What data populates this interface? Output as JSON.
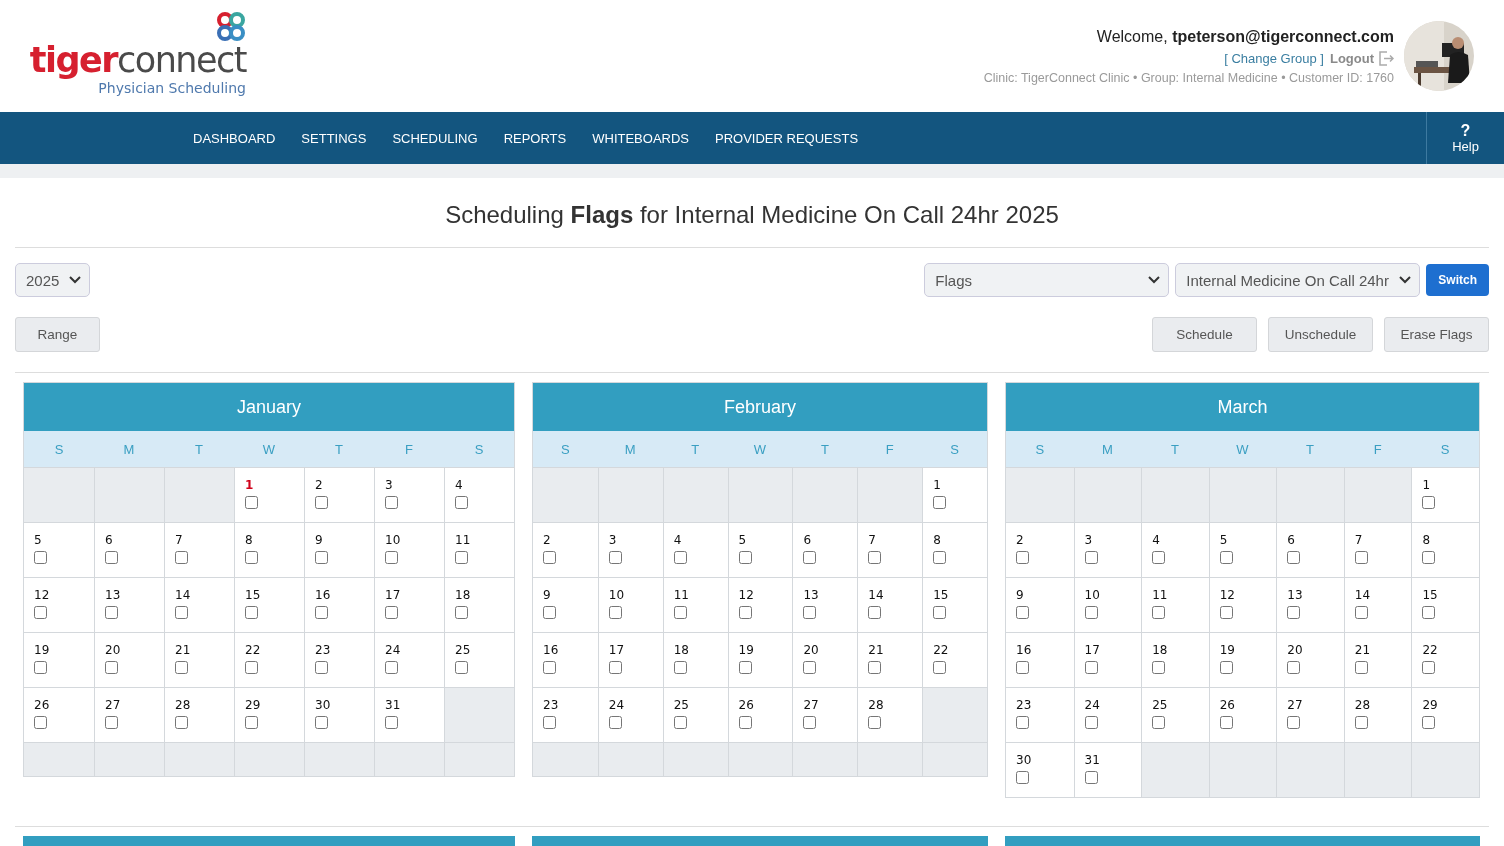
{
  "logo": {
    "brand_first": "tiger",
    "brand_second": "connect",
    "subtitle": "Physician Scheduling"
  },
  "user": {
    "welcome": "Welcome,",
    "email": "tpeterson@tigerconnect.com",
    "change_group": "[ Change Group ]",
    "logout": "Logout",
    "info": "Clinic: TigerConnect Clinic • Group: Internal Medicine • Customer ID: 1760"
  },
  "nav": {
    "items": [
      "DASHBOARD",
      "SETTINGS",
      "SCHEDULING",
      "REPORTS",
      "WHITEBOARDS",
      "PROVIDER REQUESTS"
    ],
    "help_icon": "?",
    "help": "Help"
  },
  "title": "Scheduling **Flags** for Internal Medicine On Call 24hr 2025",
  "controls": {
    "year": "2025",
    "mode": "Flags",
    "calendar": "Internal Medicine On Call 24hr",
    "switch": "Switch",
    "range": "Range",
    "actions": [
      "Schedule",
      "Unschedule",
      "Erase Flags"
    ]
  },
  "months": [
    {
      "name": "January",
      "weekdays": [
        "S",
        "M",
        "T",
        "W",
        "T",
        "F",
        "S"
      ],
      "weeks": [
        [
          {
            "kind": "blank"
          },
          {
            "kind": "blank"
          },
          {
            "kind": "blank"
          },
          {
            "kind": "day",
            "day": "1",
            "checked": false,
            "holiday": true
          },
          {
            "kind": "day",
            "day": "2",
            "checked": false,
            "holiday": false
          },
          {
            "kind": "day",
            "day": "3",
            "checked": false,
            "holiday": false
          },
          {
            "kind": "day",
            "day": "4",
            "checked": false,
            "holiday": false
          }
        ],
        [
          {
            "kind": "day",
            "day": "5",
            "checked": false,
            "holiday": false
          },
          {
            "kind": "day",
            "day": "6",
            "checked": false,
            "holiday": false
          },
          {
            "kind": "day",
            "day": "7",
            "checked": false,
            "holiday": false
          },
          {
            "kind": "day",
            "day": "8",
            "checked": false,
            "holiday": false
          },
          {
            "kind": "day",
            "day": "9",
            "checked": false,
            "holiday": false
          },
          {
            "kind": "day",
            "day": "10",
            "checked": false,
            "holiday": false
          },
          {
            "kind": "day",
            "day": "11",
            "checked": false,
            "holiday": false
          }
        ],
        [
          {
            "kind": "day",
            "day": "12",
            "checked": false,
            "holiday": false
          },
          {
            "kind": "day",
            "day": "13",
            "checked": false,
            "holiday": false
          },
          {
            "kind": "day",
            "day": "14",
            "checked": false,
            "holiday": false
          },
          {
            "kind": "day",
            "day": "15",
            "checked": false,
            "holiday": false
          },
          {
            "kind": "day",
            "day": "16",
            "checked": false,
            "holiday": false
          },
          {
            "kind": "day",
            "day": "17",
            "checked": false,
            "holiday": false
          },
          {
            "kind": "day",
            "day": "18",
            "checked": false,
            "holiday": false
          }
        ],
        [
          {
            "kind": "day",
            "day": "19",
            "checked": false,
            "holiday": false
          },
          {
            "kind": "day",
            "day": "20",
            "checked": false,
            "holiday": false
          },
          {
            "kind": "day",
            "day": "21",
            "checked": false,
            "holiday": false
          },
          {
            "kind": "day",
            "day": "22",
            "checked": false,
            "holiday": false
          },
          {
            "kind": "day",
            "day": "23",
            "checked": false,
            "holiday": false
          },
          {
            "kind": "day",
            "day": "24",
            "checked": false,
            "holiday": false
          },
          {
            "kind": "day",
            "day": "25",
            "checked": false,
            "holiday": false
          }
        ],
        [
          {
            "kind": "day",
            "day": "26",
            "checked": false,
            "holiday": false
          },
          {
            "kind": "day",
            "day": "27",
            "checked": false,
            "holiday": false
          },
          {
            "kind": "day",
            "day": "28",
            "checked": false,
            "holiday": false
          },
          {
            "kind": "day",
            "day": "29",
            "checked": false,
            "holiday": false
          },
          {
            "kind": "day",
            "day": "30",
            "checked": false,
            "holiday": false
          },
          {
            "kind": "day",
            "day": "31",
            "checked": false,
            "holiday": false
          },
          {
            "kind": "blank"
          }
        ],
        [
          {
            "kind": "blank"
          },
          {
            "kind": "blank"
          },
          {
            "kind": "blank"
          },
          {
            "kind": "blank"
          },
          {
            "kind": "blank"
          },
          {
            "kind": "blank"
          },
          {
            "kind": "blank"
          }
        ]
      ]
    },
    {
      "name": "February",
      "weekdays": [
        "S",
        "M",
        "T",
        "W",
        "T",
        "F",
        "S"
      ],
      "weeks": [
        [
          {
            "kind": "blank"
          },
          {
            "kind": "blank"
          },
          {
            "kind": "blank"
          },
          {
            "kind": "blank"
          },
          {
            "kind": "blank"
          },
          {
            "kind": "blank"
          },
          {
            "kind": "day",
            "day": "1",
            "checked": false,
            "holiday": false
          }
        ],
        [
          {
            "kind": "day",
            "day": "2",
            "checked": false,
            "holiday": false
          },
          {
            "kind": "day",
            "day": "3",
            "checked": false,
            "holiday": false
          },
          {
            "kind": "day",
            "day": "4",
            "checked": false,
            "holiday": false
          },
          {
            "kind": "day",
            "day": "5",
            "checked": false,
            "holiday": false
          },
          {
            "kind": "day",
            "day": "6",
            "checked": false,
            "holiday": false
          },
          {
            "kind": "day",
            "day": "7",
            "checked": false,
            "holiday": false
          },
          {
            "kind": "day",
            "day": "8",
            "checked": false,
            "holiday": false
          }
        ],
        [
          {
            "kind": "day",
            "day": "9",
            "checked": false,
            "holiday": false
          },
          {
            "kind": "day",
            "day": "10",
            "checked": false,
            "holiday": false
          },
          {
            "kind": "day",
            "day": "11",
            "checked": false,
            "holiday": false
          },
          {
            "kind": "day",
            "day": "12",
            "checked": false,
            "holiday": false
          },
          {
            "kind": "day",
            "day": "13",
            "checked": false,
            "holiday": false
          },
          {
            "kind": "day",
            "day": "14",
            "checked": false,
            "holiday": false
          },
          {
            "kind": "day",
            "day": "15",
            "checked": false,
            "holiday": false
          }
        ],
        [
          {
            "kind": "day",
            "day": "16",
            "checked": false,
            "holiday": false
          },
          {
            "kind": "day",
            "day": "17",
            "checked": false,
            "holiday": false
          },
          {
            "kind": "day",
            "day": "18",
            "checked": false,
            "holiday": false
          },
          {
            "kind": "day",
            "day": "19",
            "checked": false,
            "holiday": false
          },
          {
            "kind": "day",
            "day": "20",
            "checked": false,
            "holiday": false
          },
          {
            "kind": "day",
            "day": "21",
            "checked": false,
            "holiday": false
          },
          {
            "kind": "day",
            "day": "22",
            "checked": false,
            "holiday": false
          }
        ],
        [
          {
            "kind": "day",
            "day": "23",
            "checked": false,
            "holiday": false
          },
          {
            "kind": "day",
            "day": "24",
            "checked": false,
            "holiday": false
          },
          {
            "kind": "day",
            "day": "25",
            "checked": false,
            "holiday": false
          },
          {
            "kind": "day",
            "day": "26",
            "checked": false,
            "holiday": false
          },
          {
            "kind": "day",
            "day": "27",
            "checked": false,
            "holiday": false
          },
          {
            "kind": "day",
            "day": "28",
            "checked": false,
            "holiday": false
          },
          {
            "kind": "blank"
          }
        ],
        [
          {
            "kind": "blank"
          },
          {
            "kind": "blank"
          },
          {
            "kind": "blank"
          },
          {
            "kind": "blank"
          },
          {
            "kind": "blank"
          },
          {
            "kind": "blank"
          },
          {
            "kind": "blank"
          }
        ]
      ]
    },
    {
      "name": "March",
      "weekdays": [
        "S",
        "M",
        "T",
        "W",
        "T",
        "F",
        "S"
      ],
      "weeks": [
        [
          {
            "kind": "blank"
          },
          {
            "kind": "blank"
          },
          {
            "kind": "blank"
          },
          {
            "kind": "blank"
          },
          {
            "kind": "blank"
          },
          {
            "kind": "blank"
          },
          {
            "kind": "day",
            "day": "1",
            "checked": false,
            "holiday": false
          }
        ],
        [
          {
            "kind": "day",
            "day": "2",
            "checked": false,
            "holiday": false
          },
          {
            "kind": "day",
            "day": "3",
            "checked": false,
            "holiday": false
          },
          {
            "kind": "day",
            "day": "4",
            "checked": false,
            "holiday": false
          },
          {
            "kind": "day",
            "day": "5",
            "checked": false,
            "holiday": false
          },
          {
            "kind": "day",
            "day": "6",
            "checked": false,
            "holiday": false
          },
          {
            "kind": "day",
            "day": "7",
            "checked": false,
            "holiday": false
          },
          {
            "kind": "day",
            "day": "8",
            "checked": false,
            "holiday": false
          }
        ],
        [
          {
            "kind": "day",
            "day": "9",
            "checked": false,
            "holiday": false
          },
          {
            "kind": "day",
            "day": "10",
            "checked": false,
            "holiday": false
          },
          {
            "kind": "day",
            "day": "11",
            "checked": false,
            "holiday": false
          },
          {
            "kind": "day",
            "day": "12",
            "checked": false,
            "holiday": false
          },
          {
            "kind": "day",
            "day": "13",
            "checked": false,
            "holiday": false
          },
          {
            "kind": "day",
            "day": "14",
            "checked": false,
            "holiday": false
          },
          {
            "kind": "day",
            "day": "15",
            "checked": false,
            "holiday": false
          }
        ],
        [
          {
            "kind": "day",
            "day": "16",
            "checked": false,
            "holiday": false
          },
          {
            "kind": "day",
            "day": "17",
            "checked": false,
            "holiday": false
          },
          {
            "kind": "day",
            "day": "18",
            "checked": false,
            "holiday": false
          },
          {
            "kind": "day",
            "day": "19",
            "checked": false,
            "holiday": false
          },
          {
            "kind": "day",
            "day": "20",
            "checked": false,
            "holiday": false
          },
          {
            "kind": "day",
            "day": "21",
            "checked": false,
            "holiday": false
          },
          {
            "kind": "day",
            "day": "22",
            "checked": false,
            "holiday": false
          }
        ],
        [
          {
            "kind": "day",
            "day": "23",
            "checked": false,
            "holiday": false
          },
          {
            "kind": "day",
            "day": "24",
            "checked": false,
            "holiday": false
          },
          {
            "kind": "day",
            "day": "25",
            "checked": false,
            "holiday": false
          },
          {
            "kind": "day",
            "day": "26",
            "checked": false,
            "holiday": false
          },
          {
            "kind": "day",
            "day": "27",
            "checked": false,
            "holiday": false
          },
          {
            "kind": "day",
            "day": "28",
            "checked": false,
            "holiday": false
          },
          {
            "kind": "day",
            "day": "29",
            "checked": false,
            "holiday": false
          }
        ],
        [
          {
            "kind": "day",
            "day": "30",
            "checked": false,
            "holiday": false
          },
          {
            "kind": "day",
            "day": "31",
            "checked": false,
            "holiday": false
          },
          {
            "kind": "blank"
          },
          {
            "kind": "blank"
          },
          {
            "kind": "blank"
          },
          {
            "kind": "blank"
          },
          {
            "kind": "blank"
          }
        ]
      ]
    }
  ]
}
